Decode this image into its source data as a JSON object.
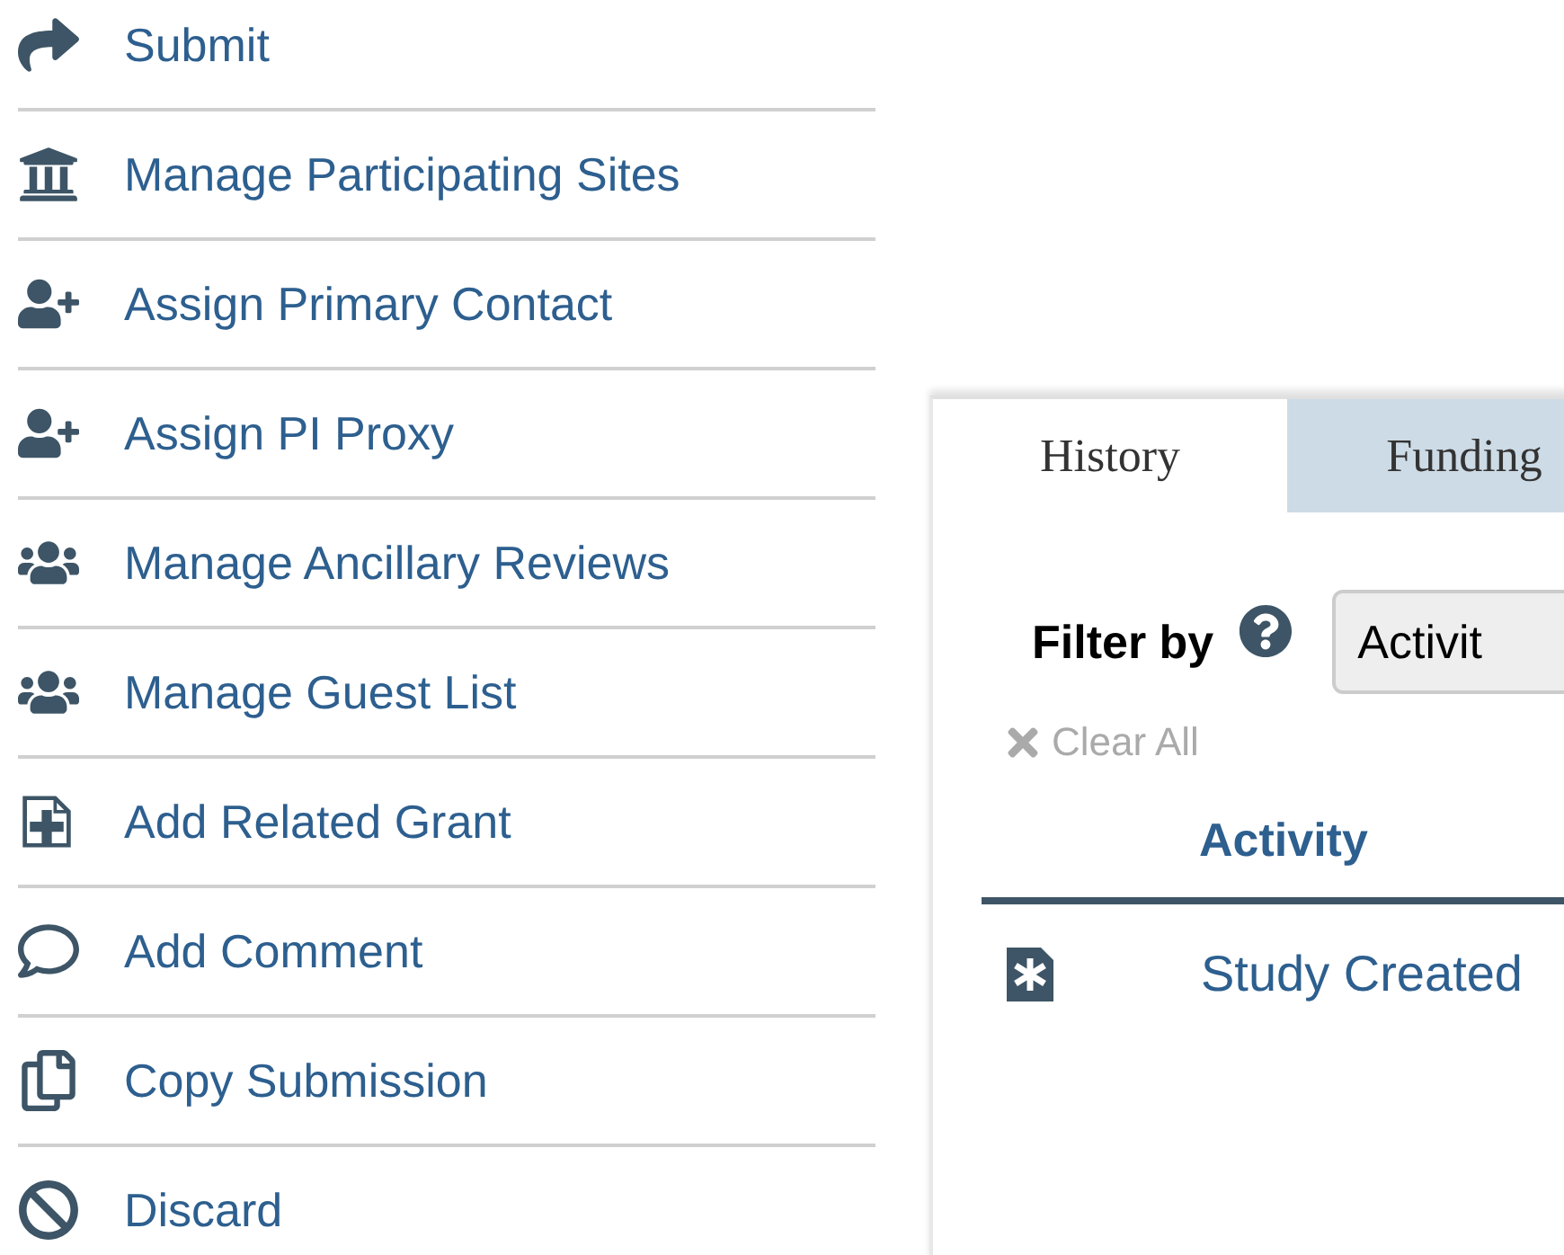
{
  "actions": [
    {
      "label": "Submit"
    },
    {
      "label": "Manage Participating Sites"
    },
    {
      "label": "Assign Primary Contact"
    },
    {
      "label": "Assign PI Proxy"
    },
    {
      "label": "Manage Ancillary Reviews"
    },
    {
      "label": "Manage Guest List"
    },
    {
      "label": "Add Related Grant"
    },
    {
      "label": "Add Comment"
    },
    {
      "label": "Copy Submission"
    },
    {
      "label": "Discard"
    }
  ],
  "tabs": [
    {
      "label": "History",
      "selected": true
    },
    {
      "label": "Funding",
      "selected": false
    }
  ],
  "filter": {
    "label": "Filter by",
    "dropdown": "Activit",
    "clear": "Clear All"
  },
  "table": {
    "columns": [
      "Activity"
    ],
    "rows": [
      {
        "activity": "Study Created"
      }
    ]
  }
}
